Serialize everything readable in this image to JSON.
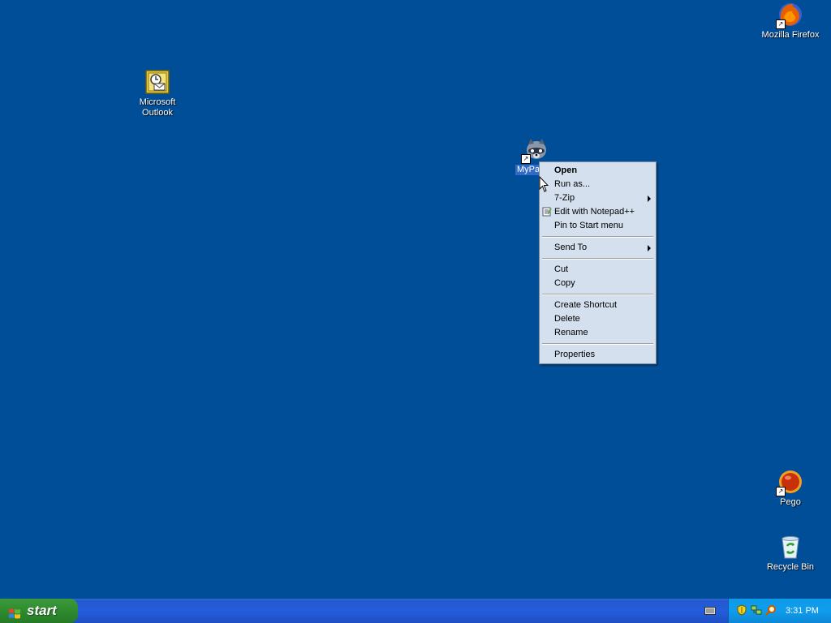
{
  "desktop": {
    "icons": {
      "outlook": {
        "line1": "Microsoft",
        "line2": "Outlook"
      },
      "firefox": {
        "label": "Mozilla Firefox"
      },
      "mypass": {
        "label": "MyPa"
      },
      "pego": {
        "label": "Pego"
      },
      "recycle": {
        "label": "Recycle Bin"
      }
    }
  },
  "context_menu": {
    "open": "Open",
    "run_as": "Run as...",
    "seven_zip": "7-Zip",
    "notepad": "Edit with Notepad++",
    "pin": "Pin to Start menu",
    "send_to": "Send To",
    "cut": "Cut",
    "copy": "Copy",
    "create_shortcut": "Create Shortcut",
    "delete": "Delete",
    "rename": "Rename",
    "properties": "Properties"
  },
  "taskbar": {
    "start_label": "start",
    "clock": "3:31 PM"
  },
  "colors": {
    "desktop_bg": "#004e98",
    "taskbar": "#245edb",
    "start": "#2e8b2e",
    "tray": "#109ded",
    "menu_bg": "#d4e0ee"
  }
}
